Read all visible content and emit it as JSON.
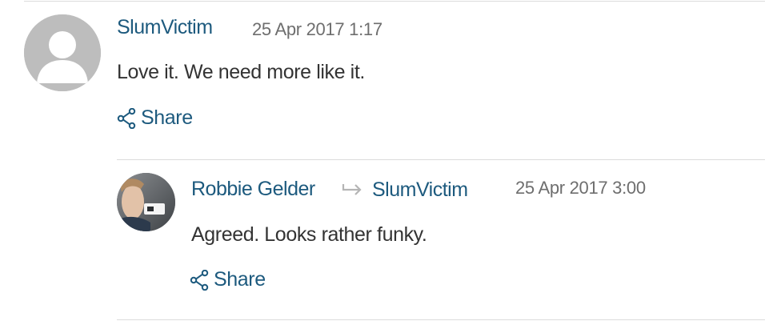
{
  "comments": [
    {
      "author": "SlumVictim",
      "timestamp": "25 Apr 2017 1:17",
      "text": "Love it. We need more like it.",
      "share_label": "Share",
      "avatar_icon": "default-user-avatar"
    },
    {
      "author": "Robbie Gelder",
      "reply_to": "SlumVictim",
      "timestamp": "25 Apr 2017 3:00",
      "text": "Agreed. Looks rather funky.",
      "share_label": "Share",
      "avatar_icon": "user-photo-avatar"
    }
  ],
  "colors": {
    "link": "#1d5a7e",
    "meta": "#6e6e6e",
    "text": "#333333",
    "divider": "#dcdcdc"
  }
}
